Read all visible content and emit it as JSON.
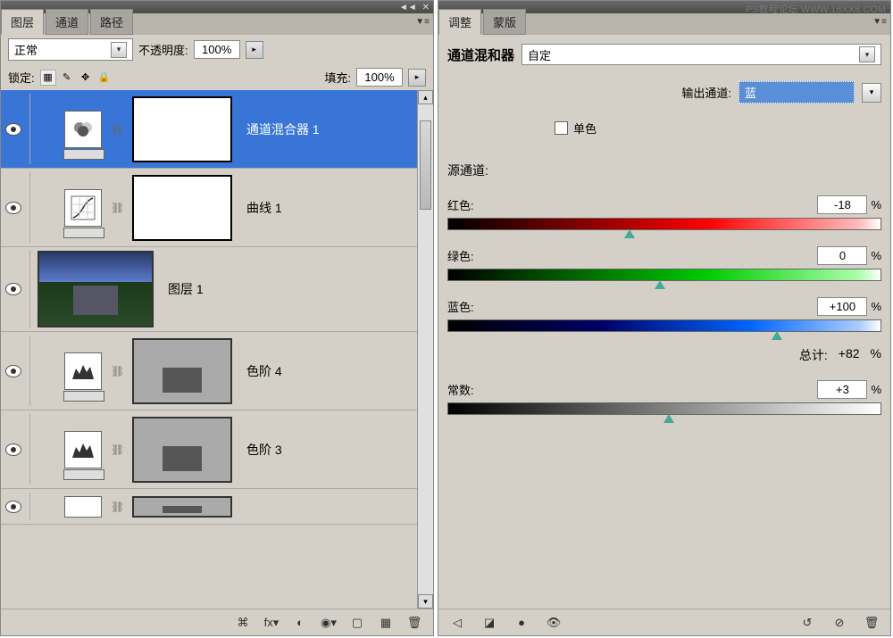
{
  "watermark": "PS教程论坛 WWW.16XX8.COM",
  "titlebar": {
    "collapse": "◄◄",
    "close": "✕"
  },
  "layers_panel": {
    "tabs": {
      "layers": "图层",
      "channels": "通道",
      "paths": "路径",
      "menu": "▼≡"
    },
    "blend_mode": "正常",
    "opacity_label": "不透明度:",
    "opacity_value": "100%",
    "lock_label": "锁定:",
    "fill_label": "填充:",
    "fill_value": "100%",
    "layers": [
      {
        "name": "通道混合器 1",
        "type": "adj",
        "selected": true
      },
      {
        "name": "曲线 1",
        "type": "adj"
      },
      {
        "name": "图层 1",
        "type": "img"
      },
      {
        "name": "色阶 4",
        "type": "adj_img"
      },
      {
        "name": "色阶 3",
        "type": "adj_img"
      },
      {
        "name": "",
        "type": "adj_img"
      }
    ],
    "bottom_icons": [
      "⌘",
      "fx▾",
      "◐",
      "◉▾",
      "▢",
      "▦",
      "🗑"
    ]
  },
  "adj_panel": {
    "tabs": {
      "adjustments": "调整",
      "masks": "蒙版",
      "menu": "▼≡"
    },
    "title": "通道混和器",
    "preset": "自定",
    "output_label": "输出通道:",
    "output_value": "蓝",
    "mono_label": "单色",
    "source_label": "源通道:",
    "sliders": {
      "red": {
        "label": "红色:",
        "value": "-18",
        "unit": "%",
        "pos": 42
      },
      "green": {
        "label": "绿色:",
        "value": "0",
        "unit": "%",
        "pos": 49
      },
      "blue": {
        "label": "蓝色:",
        "value": "+100",
        "unit": "%",
        "pos": 76
      },
      "constant": {
        "label": "常数:",
        "value": "+3",
        "unit": "%",
        "pos": 51
      }
    },
    "total_label": "总计:",
    "total_value": "+82",
    "total_unit": "%",
    "bottom_left": [
      "◁",
      "◪",
      "●",
      "👁"
    ],
    "bottom_right": [
      "↺",
      "⊘",
      "🗑"
    ]
  }
}
